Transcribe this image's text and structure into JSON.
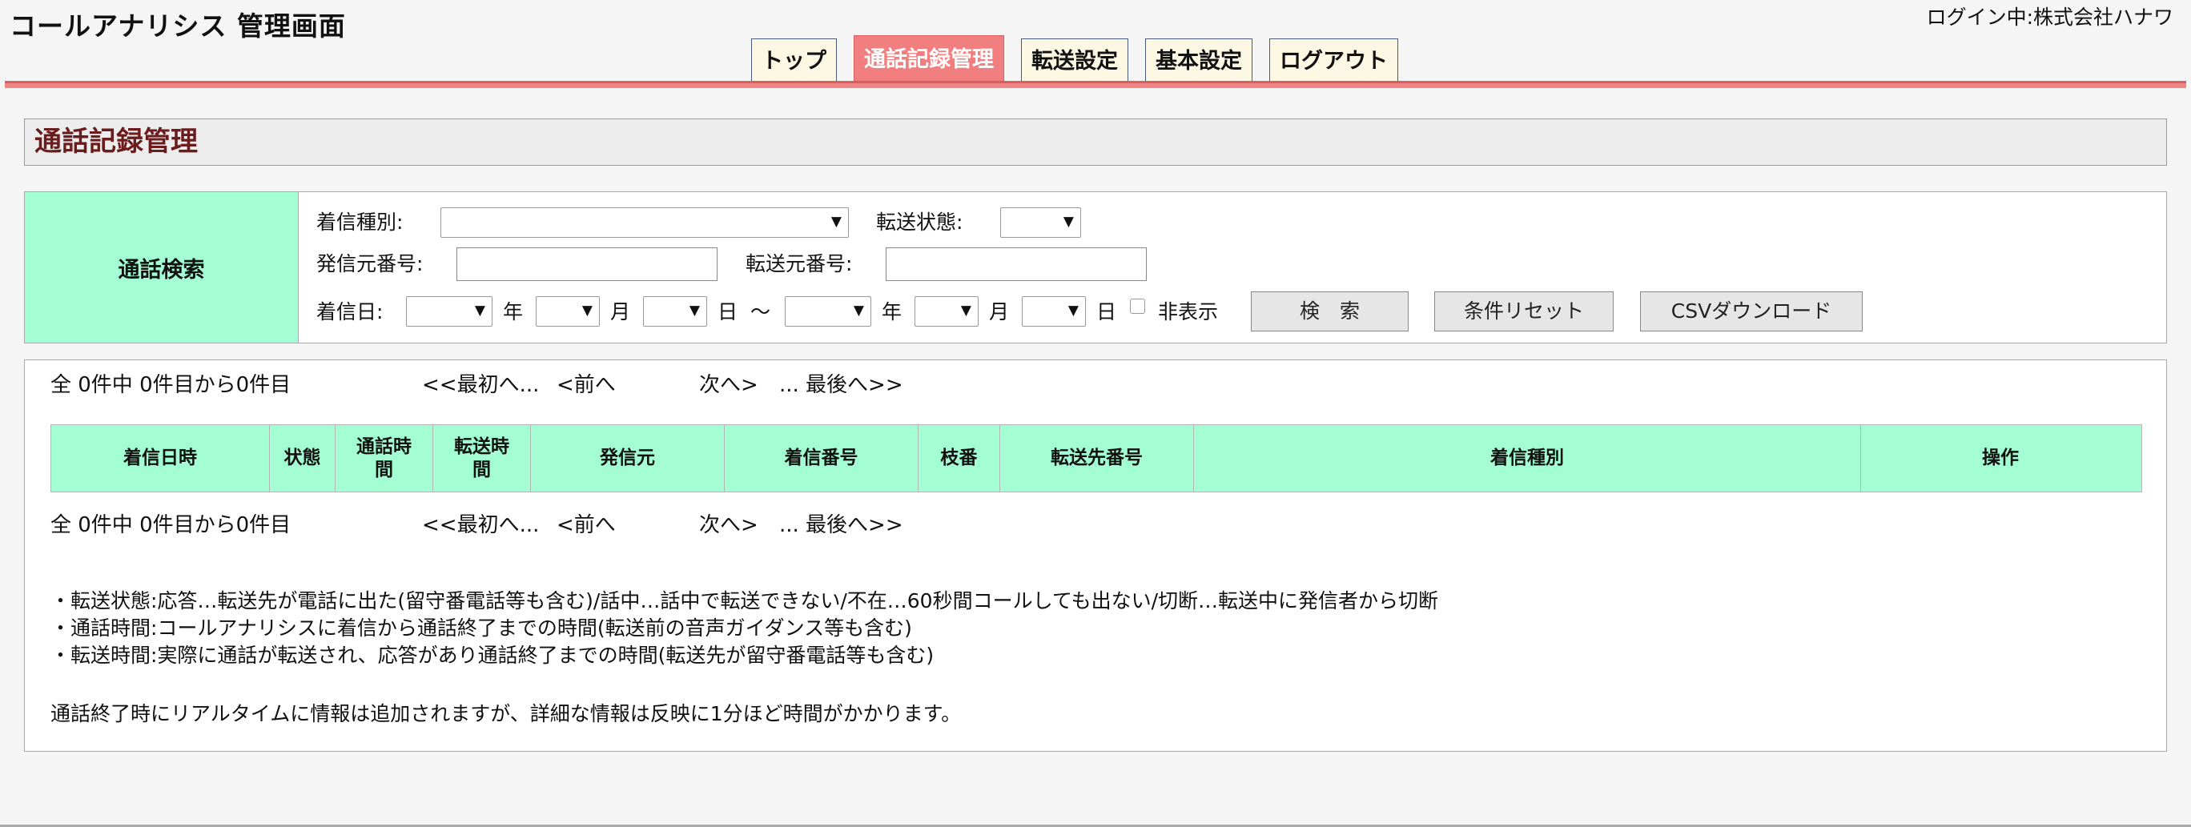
{
  "header": {
    "app_title": "コールアナリシス 管理画面",
    "login_info": "ログイン中:株式会社ハナワ"
  },
  "nav": {
    "tabs": [
      {
        "label": "トップ",
        "active": false
      },
      {
        "label": "通話記録管理",
        "active": true
      },
      {
        "label": "転送設定",
        "active": false
      },
      {
        "label": "基本設定",
        "active": false
      },
      {
        "label": "ログアウト",
        "active": false
      }
    ]
  },
  "page": {
    "title": "通話記録管理"
  },
  "search": {
    "section_label": "通話検索",
    "call_type_label": "着信種別:",
    "call_type_value": "",
    "transfer_status_label": "転送状態:",
    "transfer_status_value": "",
    "caller_number_label": "発信元番号:",
    "caller_number_value": "",
    "transfer_source_label": "転送元番号:",
    "transfer_source_value": "",
    "date_label": "着信日:",
    "year_label": "年",
    "month_label": "月",
    "day_label": "日",
    "range_sep": "〜",
    "hide_label": "非表示",
    "hide_checked": false,
    "search_button": "検　索",
    "reset_button": "条件リセット",
    "csv_button": "CSVダウンロード"
  },
  "results": {
    "summary": "全 0件中 0件目から0件目",
    "first": "<<最初へ...",
    "prev": "<前へ",
    "next": "次へ>",
    "last": "... 最後へ>>",
    "columns": [
      "着信日時",
      "状態",
      "通話時間",
      "転送時間",
      "発信元",
      "着信番号",
      "枝番",
      "転送先番号",
      "着信種別",
      "操作"
    ],
    "rows": []
  },
  "notes": [
    "・転送状態:応答…転送先が電話に出た(留守番電話等も含む)/話中…話中で転送できない/不在…60秒間コールしても出ない/切断…転送中に発信者から切断",
    "・通話時間:コールアナリシスに着信から通話終了までの時間(転送前の音声ガイダンス等も含む)",
    "・転送時間:実際に通話が転送され、応答があり通話終了までの時間(転送先が留守番電話等も含む)"
  ],
  "footer_note": "通話終了時にリアルタイムに情報は追加されますが、詳細な情報は反映に1分ほど時間がかかります。",
  "colors": {
    "accent_pink": "#f27f7f",
    "mint": "#a3fed3",
    "title_red": "#6b1c1c",
    "tab_bg": "#fdf8e3"
  }
}
